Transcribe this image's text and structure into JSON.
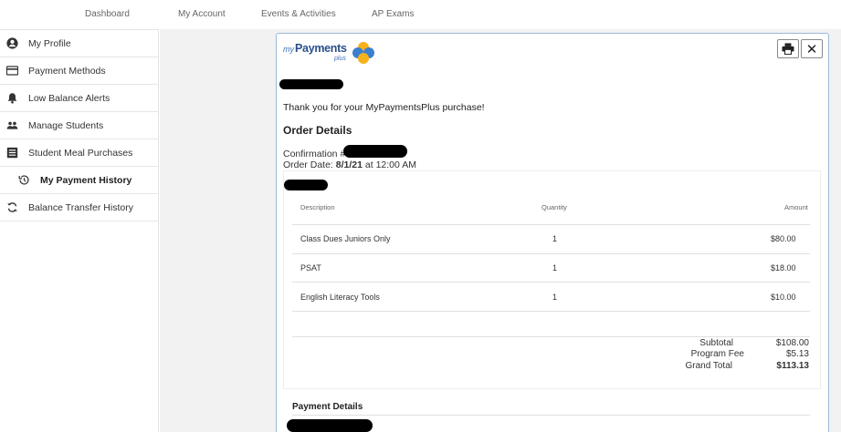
{
  "nav": [
    "Dashboard",
    "My Account",
    "Events & Activities",
    "AP Exams"
  ],
  "sidebar": [
    {
      "label": "My Profile",
      "icon": "user-circle-icon"
    },
    {
      "label": "Payment Methods",
      "icon": "credit-card-icon"
    },
    {
      "label": "Low Balance Alerts",
      "icon": "bell-icon"
    },
    {
      "label": "Manage Students",
      "icon": "users-icon"
    },
    {
      "label": "Student Meal Purchases",
      "icon": "list-icon"
    },
    {
      "label": "My Payment History",
      "icon": "history-icon",
      "active": true
    },
    {
      "label": "Balance Transfer History",
      "icon": "sync-icon"
    }
  ],
  "receipt": {
    "logo": {
      "my": "my",
      "payments": "Payments",
      "plus": "plus"
    },
    "thanks": "Thank you for your MyPaymentsPlus purchase!",
    "order_title": "Order Details",
    "confirmation_label": "Confirmation #",
    "order_date_label": "Order Date:",
    "order_date": "8/1/21",
    "order_time": "at 12:00 AM",
    "columns": [
      "Description",
      "Quantity",
      "Amount"
    ],
    "items": [
      {
        "description": "Class Dues Juniors Only",
        "quantity": "1",
        "amount": "$80.00"
      },
      {
        "description": "PSAT",
        "quantity": "1",
        "amount": "$18.00"
      },
      {
        "description": "English Literacy Tools",
        "quantity": "1",
        "amount": "$10.00"
      }
    ],
    "totals": [
      {
        "label": "Subtotal",
        "value": "$108.00"
      },
      {
        "label": "Program Fee",
        "value": "$5.13"
      },
      {
        "label": "Grand Total",
        "value": "$113.13"
      }
    ],
    "payment_details_title": "Payment Details"
  }
}
